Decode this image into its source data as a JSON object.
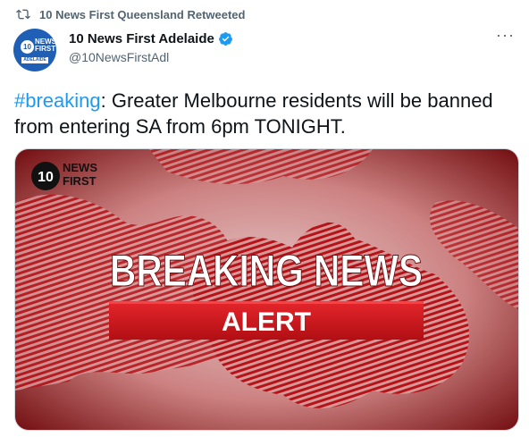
{
  "retweet": {
    "icon": "retweet-icon",
    "label": "10 News First Queensland Retweeted"
  },
  "author": {
    "avatar_icon": "10-news-first-adelaide-logo",
    "avatar_number": "10",
    "avatar_text_line1": "NEWS",
    "avatar_text_line2": "FIRST",
    "avatar_text_line3": "ADELAIDE",
    "display_name": "10 News First Adelaide",
    "verified_icon": "verified-badge-icon",
    "handle": "@10NewsFirstAdl"
  },
  "more_options": {
    "icon": "more-options-icon",
    "label": "···"
  },
  "tweet": {
    "hashtag": "#breaking",
    "text": ": Greater Melbourne residents will be banned from entering SA from 6pm TONIGHT."
  },
  "media": {
    "logo_number": "10",
    "logo_line1": "NEWS",
    "logo_line2": "FIRST",
    "headline": "BREAKING NEWS",
    "banner": "ALERT"
  },
  "colors": {
    "accent": "#1d9bf0",
    "secondary_text": "#536471",
    "banner_red": "#d0161c",
    "background_red": "#b31b1f"
  }
}
